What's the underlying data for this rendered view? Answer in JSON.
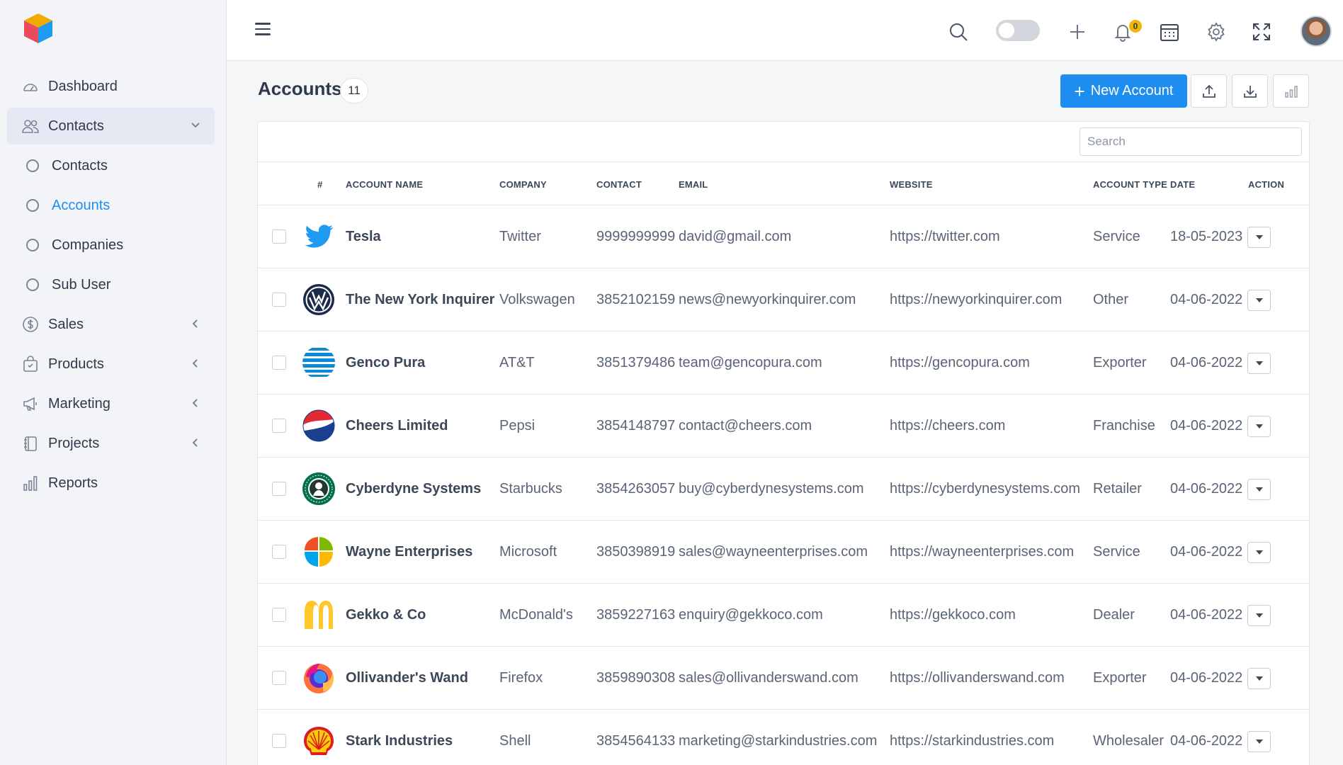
{
  "sidebar": {
    "items": [
      {
        "label": "Dashboard",
        "icon": "speedometer-icon"
      },
      {
        "label": "Contacts",
        "icon": "users-icon",
        "expanded": true
      },
      {
        "label": "Sales",
        "icon": "dollar-icon"
      },
      {
        "label": "Products",
        "icon": "shopping-bag-icon"
      },
      {
        "label": "Marketing",
        "icon": "megaphone-icon"
      },
      {
        "label": "Projects",
        "icon": "notebook-icon"
      },
      {
        "label": "Reports",
        "icon": "bar-chart-icon"
      }
    ],
    "contacts_sub": [
      {
        "label": "Contacts"
      },
      {
        "label": "Accounts",
        "active": true
      },
      {
        "label": "Companies"
      },
      {
        "label": "Sub User"
      }
    ]
  },
  "header": {
    "notification_count": "0"
  },
  "page": {
    "title": "Accounts",
    "count": "11",
    "new_button": "New Account",
    "search_placeholder": "Search"
  },
  "table": {
    "columns": {
      "num": "#",
      "account_name": "ACCOUNT NAME",
      "company": "COMPANY",
      "contact": "CONTACT",
      "email": "EMAIL",
      "website": "WEBSITE",
      "account_type": "ACCOUNT TYPE",
      "date": "DATE",
      "action": "ACTION"
    },
    "rows": [
      {
        "name": "Tesla",
        "company": "Twitter",
        "contact": "9999999999",
        "email": "david@gmail.com",
        "website": "https://twitter.com",
        "type": "Service",
        "date": "18-05-2023",
        "logo": "twitter-logo-icon"
      },
      {
        "name": "The New York Inquirer",
        "company": "Volkswagen",
        "contact": "3852102159",
        "email": "news@newyorkinquirer.com",
        "website": "https://newyorkinquirer.com",
        "type": "Other",
        "date": "04-06-2022",
        "logo": "volkswagen-logo-icon"
      },
      {
        "name": "Genco Pura",
        "company": "AT&T",
        "contact": "3851379486",
        "email": "team@gencopura.com",
        "website": "https://gencopura.com",
        "type": "Exporter",
        "date": "04-06-2022",
        "logo": "att-logo-icon"
      },
      {
        "name": "Cheers Limited",
        "company": "Pepsi",
        "contact": "3854148797",
        "email": "contact@cheers.com",
        "website": "https://cheers.com",
        "type": "Franchise",
        "date": "04-06-2022",
        "logo": "pepsi-logo-icon"
      },
      {
        "name": "Cyberdyne Systems",
        "company": "Starbucks",
        "contact": "3854263057",
        "email": "buy@cyberdynesystems.com",
        "website": "https://cyberdynesystems.com",
        "type": "Retailer",
        "date": "04-06-2022",
        "logo": "starbucks-logo-icon"
      },
      {
        "name": "Wayne Enterprises",
        "company": "Microsoft",
        "contact": "3850398919",
        "email": "sales@wayneenterprises.com",
        "website": "https://wayneenterprises.com",
        "type": "Service",
        "date": "04-06-2022",
        "logo": "microsoft-logo-icon"
      },
      {
        "name": "Gekko & Co",
        "company": "McDonald's",
        "contact": "3859227163",
        "email": "enquiry@gekkoco.com",
        "website": "https://gekkoco.com",
        "type": "Dealer",
        "date": "04-06-2022",
        "logo": "mcdonalds-logo-icon"
      },
      {
        "name": "Ollivander's Wand",
        "company": "Firefox",
        "contact": "3859890308",
        "email": "sales@ollivanderswand.com",
        "website": "https://ollivanderswand.com",
        "type": "Exporter",
        "date": "04-06-2022",
        "logo": "firefox-logo-icon"
      },
      {
        "name": "Stark Industries",
        "company": "Shell",
        "contact": "3854564133",
        "email": "marketing@starkindustries.com",
        "website": "https://starkindustries.com",
        "type": "Wholesaler",
        "date": "04-06-2022",
        "logo": "shell-logo-icon"
      }
    ]
  },
  "colors": {
    "primary": "#1d8ef0",
    "sidebar_bg": "#f3f4f7",
    "badge": "#f2b705"
  }
}
